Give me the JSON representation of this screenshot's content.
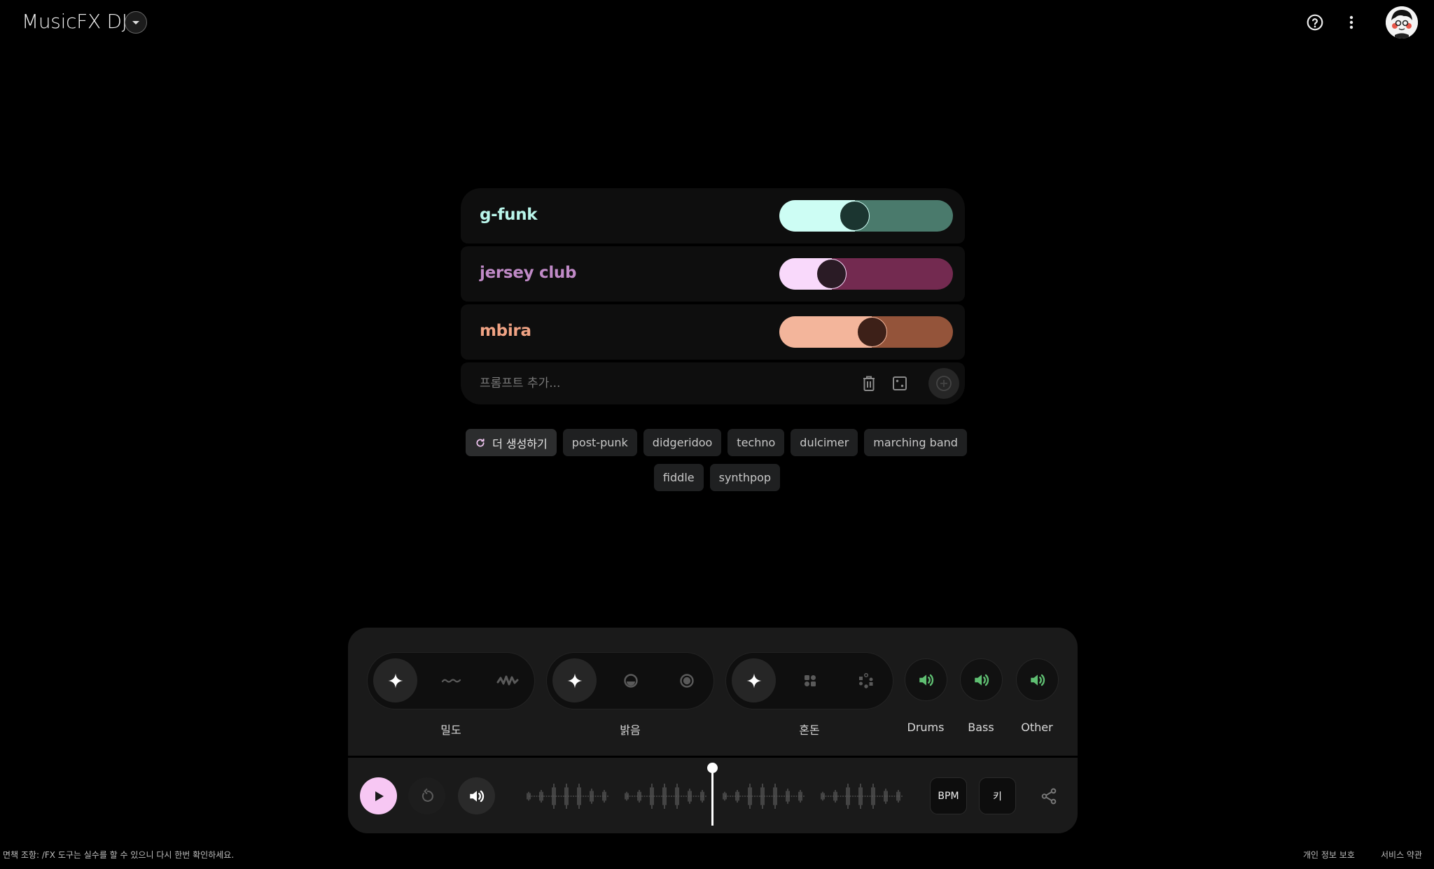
{
  "header": {
    "title": "MusicFX DJ",
    "icons": [
      "caret-down-icon",
      "help-icon",
      "more-vert-icon",
      "avatar"
    ]
  },
  "prompts": [
    {
      "label": "g-funk",
      "weight": 0.42,
      "colors": {
        "text": "#b9f5ea",
        "light": "#cdfdf4",
        "dark": "#4a7a6c",
        "knob": "#1b3530"
      }
    },
    {
      "label": "jersey club",
      "weight": 0.26,
      "colors": {
        "text": "#c08ac7",
        "light": "#f9d9fb",
        "dark": "#732a50",
        "knob": "#2a1b25"
      }
    },
    {
      "label": "mbira",
      "weight": 0.54,
      "colors": {
        "text": "#f0a384",
        "light": "#f3b59b",
        "dark": "#94543a",
        "knob": "#3d2018"
      }
    }
  ],
  "prompt_input": {
    "placeholder": "프롬프트 추가...",
    "value": ""
  },
  "prompt_actions": {
    "delete_icon": "trash-icon",
    "random_icon": "dice-icon",
    "add_icon": "add-circle-icon"
  },
  "suggestions": {
    "generate_more_label": "더 생성하기",
    "row1": [
      "post-punk",
      "didgeridoo",
      "techno",
      "dulcimer",
      "marching band"
    ],
    "row2": [
      "fiddle",
      "synthpop"
    ]
  },
  "controls": {
    "density": {
      "label": "밀도",
      "options": [
        "auto-sparkle-icon",
        "low-wave-icon",
        "high-wave-icon"
      ],
      "selected": 0
    },
    "brightness": {
      "label": "밝음",
      "options": [
        "auto-sparkle-icon",
        "dim-circle-icon",
        "bright-circle-icon"
      ],
      "selected": 0
    },
    "chaos": {
      "label": "혼돈",
      "options": [
        "auto-sparkle-icon",
        "ordered-grid-icon",
        "scattered-dots-icon"
      ],
      "selected": 0
    },
    "stems": [
      {
        "label": "Drums",
        "enabled": true
      },
      {
        "label": "Bass",
        "enabled": true
      },
      {
        "label": "Other",
        "enabled": true
      }
    ],
    "stem_color": "#5fbf72"
  },
  "transport": {
    "play_accent": "#f7c7f3",
    "bpm_label": "BPM",
    "key_label": "키",
    "playhead_position": 0.5
  },
  "footer": {
    "disclaimer": "면책 조항: /FX 도구는 실수를 할 수 있으니 다시 한번 확인하세요.",
    "privacy": "개인 정보 보호",
    "terms": "서비스 약관"
  }
}
